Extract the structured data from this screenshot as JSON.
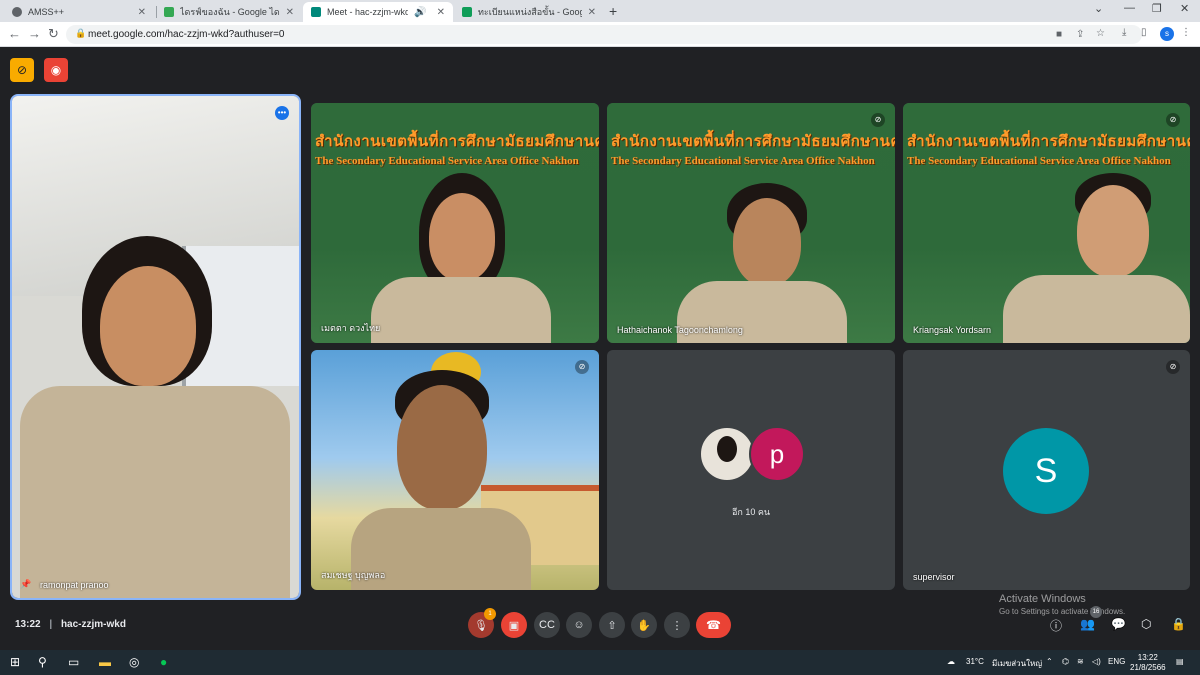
{
  "browser": {
    "tabs": [
      {
        "title": "AMSS++",
        "color": "#5f6368",
        "active": false
      },
      {
        "title": "ไดรฟ์ของฉัน - Google ไดรฟ์",
        "color": "#34a853",
        "active": false
      },
      {
        "title": "Meet - hac-zzjm-wkd",
        "color": "#00897b",
        "active": true
      },
      {
        "title": "ทะเบียนแหน่งสือขั้น - Google ชีต",
        "color": "#0f9d58",
        "active": false
      }
    ],
    "url": "meet.google.com/hac-zzjm-wkd?authuser=0",
    "profile_initial": "s"
  },
  "meet": {
    "tiles": [
      {
        "name": "ramonpat pranoo",
        "speaking": true,
        "pinned": true
      },
      {
        "name": "เมตตา ดวงไทย",
        "banner1": "สำนักงานเขตพื้นที่การศึกษามัธยมศึกษานครช",
        "banner2": "The Secondary Educational Service Area Office Nakhon"
      },
      {
        "name": "Hathaichanok Tagoonchamlong",
        "banner1": "สำนักงานเขตพื้นที่การศึกษามัธยมศึกษานครช",
        "banner2": "The Secondary Educational Service Area Office Nakhon",
        "muted": true
      },
      {
        "name": "Kriangsak Yordsarn",
        "banner1": "สำนักงานเขตพื้นที่การศึกษามัธยมศึกษานครช",
        "banner2": "The Secondary Educational Service Area Office Nakhon",
        "muted": true
      },
      {
        "name": "สมเชษฐ บุญพลอ",
        "muted": true
      },
      {
        "name": "",
        "others_label": "อีก 10 คน",
        "avatar_letter": "p",
        "avatar_color": "#c2185b"
      },
      {
        "name": "supervisor",
        "avatar_letter": "S",
        "avatar_color": "#0097a7",
        "muted": true
      }
    ],
    "meeting_time": "13:22",
    "meeting_code": "hac-zzjm-wkd",
    "participants_count": "16",
    "raise_badge": "1"
  },
  "watermark": {
    "line1": "Activate Windows",
    "line2": "Go to Settings to activate Windows."
  },
  "taskbar": {
    "temperature": "31°C",
    "weather_text": "มีเมฆส่วนใหญ่",
    "language": "ENG",
    "clock_time": "13:22",
    "clock_date": "21/8/2566"
  }
}
